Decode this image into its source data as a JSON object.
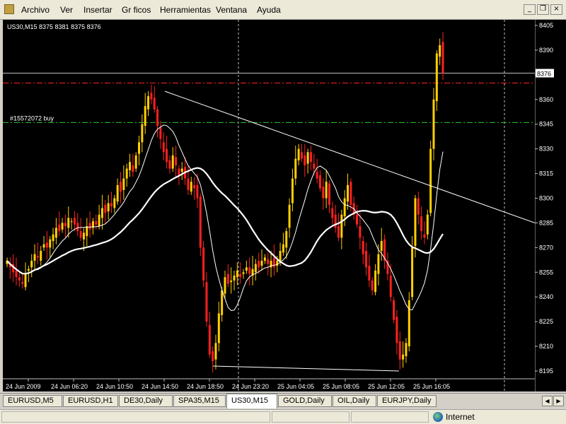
{
  "menu": {
    "items": [
      "Archivo",
      "Ver",
      "Insertar",
      "Gr ficos",
      "Herramientas",
      "Ventana",
      "Ayuda"
    ]
  },
  "window_controls": {
    "minimize": "_",
    "restore": "❐",
    "close": "×"
  },
  "chart": {
    "header": "US30,M15  8375 8381 8375 8376",
    "order_label": "#15572072 buy",
    "price_tag": "8376",
    "colors": {
      "bull": "#ffd000",
      "bear": "#ff2020",
      "ma": "#ffffff",
      "bid": "#c0c0c0",
      "sl": "#ff2020",
      "order": "#2ec82e",
      "trend": "#ffffff",
      "grid": "#c0c0c0"
    }
  },
  "chart_data": {
    "type": "candlestick",
    "symbol": "US30",
    "timeframe": "M15",
    "ohlc_last": {
      "open": 8375,
      "high": 8381,
      "low": 8375,
      "close": 8376
    },
    "y_ticks": [
      8405,
      8390,
      8375,
      8360,
      8345,
      8330,
      8315,
      8300,
      8285,
      8270,
      8255,
      8240,
      8225,
      8210,
      8195
    ],
    "x_ticks": [
      "24 Jun 2009",
      "24 Jun 06:20",
      "24 Jun 10:50",
      "24 Jun 14:50",
      "24 Jun 18:50",
      "24 Jun 23:20",
      "25 Jun 04:05",
      "25 Jun 08:05",
      "25 Jun 12:05",
      "25 Jun 16:05"
    ],
    "ylim": [
      8191,
      8409
    ],
    "bid_line": 8376,
    "stop_line": 8370,
    "order_line": 8346,
    "close_pattern": [
      8262,
      8258,
      8255,
      8252,
      8250,
      8248,
      8254,
      8257,
      8262,
      8266,
      8264,
      8268,
      8272,
      8270,
      8275,
      8278,
      8282,
      8280,
      8285,
      8283,
      8288,
      8286,
      8284,
      8280,
      8276,
      8279,
      8283,
      8281,
      8286,
      8284,
      8290,
      8294,
      8291,
      8297,
      8295,
      8300,
      8308,
      8304,
      8312,
      8318,
      8322,
      8316,
      8326,
      8334,
      8345,
      8356,
      8362,
      8360,
      8354,
      8344,
      8336,
      8328,
      8322,
      8318,
      8326,
      8320,
      8314,
      8318,
      8312,
      8305,
      8310,
      8306,
      8300,
      8270,
      8250,
      8225,
      8205,
      8201,
      8212,
      8230,
      8244,
      8252,
      8248,
      8250,
      8253,
      8256,
      8252,
      8255,
      8258,
      8254,
      8257,
      8260,
      8258,
      8262,
      8264,
      8260,
      8262,
      8258,
      8262,
      8268,
      8272,
      8280,
      8296,
      8312,
      8324,
      8330,
      8324,
      8320,
      8328,
      8322,
      8318,
      8312,
      8306,
      8300,
      8310,
      8296,
      8288,
      8282,
      8276,
      8290,
      8300,
      8308,
      8296,
      8290,
      8284,
      8276,
      8266,
      8258,
      8250,
      8244,
      8256,
      8266,
      8274,
      8262,
      8254,
      8240,
      8226,
      8212,
      8202,
      8205,
      8212,
      8238,
      8270,
      8300,
      8290,
      8280,
      8276,
      8290,
      8330,
      8360,
      8388,
      8393,
      8376
    ]
  },
  "tabs": [
    {
      "label": "EURUSD,M5"
    },
    {
      "label": "EURUSD,H1"
    },
    {
      "label": "DE30,Daily"
    },
    {
      "label": "SPA35,M15"
    },
    {
      "label": "US30,M15"
    },
    {
      "label": "GOLD,Daily"
    },
    {
      "label": "OIL,Daily"
    },
    {
      "label": "EURJPY,Daily"
    }
  ],
  "status": {
    "text": "Internet"
  }
}
